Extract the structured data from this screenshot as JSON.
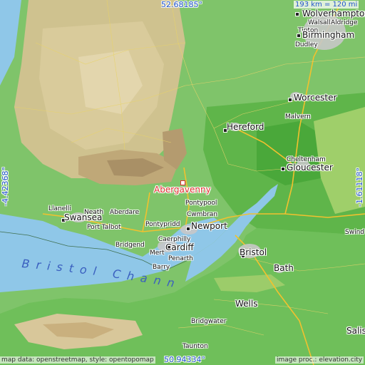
{
  "map": {
    "highlight_place": "Abergavenny",
    "coords": {
      "top": "52.68185°",
      "bottom": "50.94334°",
      "left": "-4.42368°",
      "right": "-1.61118°"
    },
    "scale_text": "193 km = 120 mi",
    "credit_left": "map data: openstreetmap, style: opentopomap",
    "credit_right": "image proc.: elevation.city",
    "sea_label": "Bristol Channel",
    "places": [
      {
        "key": "wolverhampton",
        "name": "Wolverhampton"
      },
      {
        "key": "walsall",
        "name": "Walsall"
      },
      {
        "key": "aldridge",
        "name": "Aldridge"
      },
      {
        "key": "tipton",
        "name": "Tipton"
      },
      {
        "key": "birmingham",
        "name": "Birmingham"
      },
      {
        "key": "dudley",
        "name": "Dudley"
      },
      {
        "key": "worcester",
        "name": "Worcester"
      },
      {
        "key": "malvern",
        "name": "Malvern"
      },
      {
        "key": "hereford",
        "name": "Hereford"
      },
      {
        "key": "cheltenham",
        "name": "Cheltenham"
      },
      {
        "key": "gloucester",
        "name": "Gloucester"
      },
      {
        "key": "pontypool",
        "name": "Pontypool"
      },
      {
        "key": "cwmbran",
        "name": "Cwmbran"
      },
      {
        "key": "newport",
        "name": "Newport"
      },
      {
        "key": "llanelli",
        "name": "Llanelli"
      },
      {
        "key": "swansea",
        "name": "Swansea"
      },
      {
        "key": "neath",
        "name": "Neath"
      },
      {
        "key": "aberdare",
        "name": "Aberdare"
      },
      {
        "key": "port_talbot",
        "name": "Port Talbot"
      },
      {
        "key": "pontypridd",
        "name": "Pontypridd"
      },
      {
        "key": "caerphilly",
        "name": "Caerphilly"
      },
      {
        "key": "bridgend",
        "name": "Bridgend"
      },
      {
        "key": "cardiff",
        "name": "Cardiff"
      },
      {
        "key": "penarth",
        "name": "Penarth"
      },
      {
        "key": "barry",
        "name": "Barry"
      },
      {
        "key": "bristol",
        "name": "Bristol"
      },
      {
        "key": "bath",
        "name": "Bath"
      },
      {
        "key": "wells",
        "name": "Wells"
      },
      {
        "key": "bridgwater",
        "name": "Bridgwater"
      },
      {
        "key": "taunton",
        "name": "Taunton"
      },
      {
        "key": "salisbury",
        "name": "Salis"
      },
      {
        "key": "swindon",
        "name": "Swind"
      },
      {
        "key": "merthyr",
        "name": "Mert"
      }
    ]
  }
}
